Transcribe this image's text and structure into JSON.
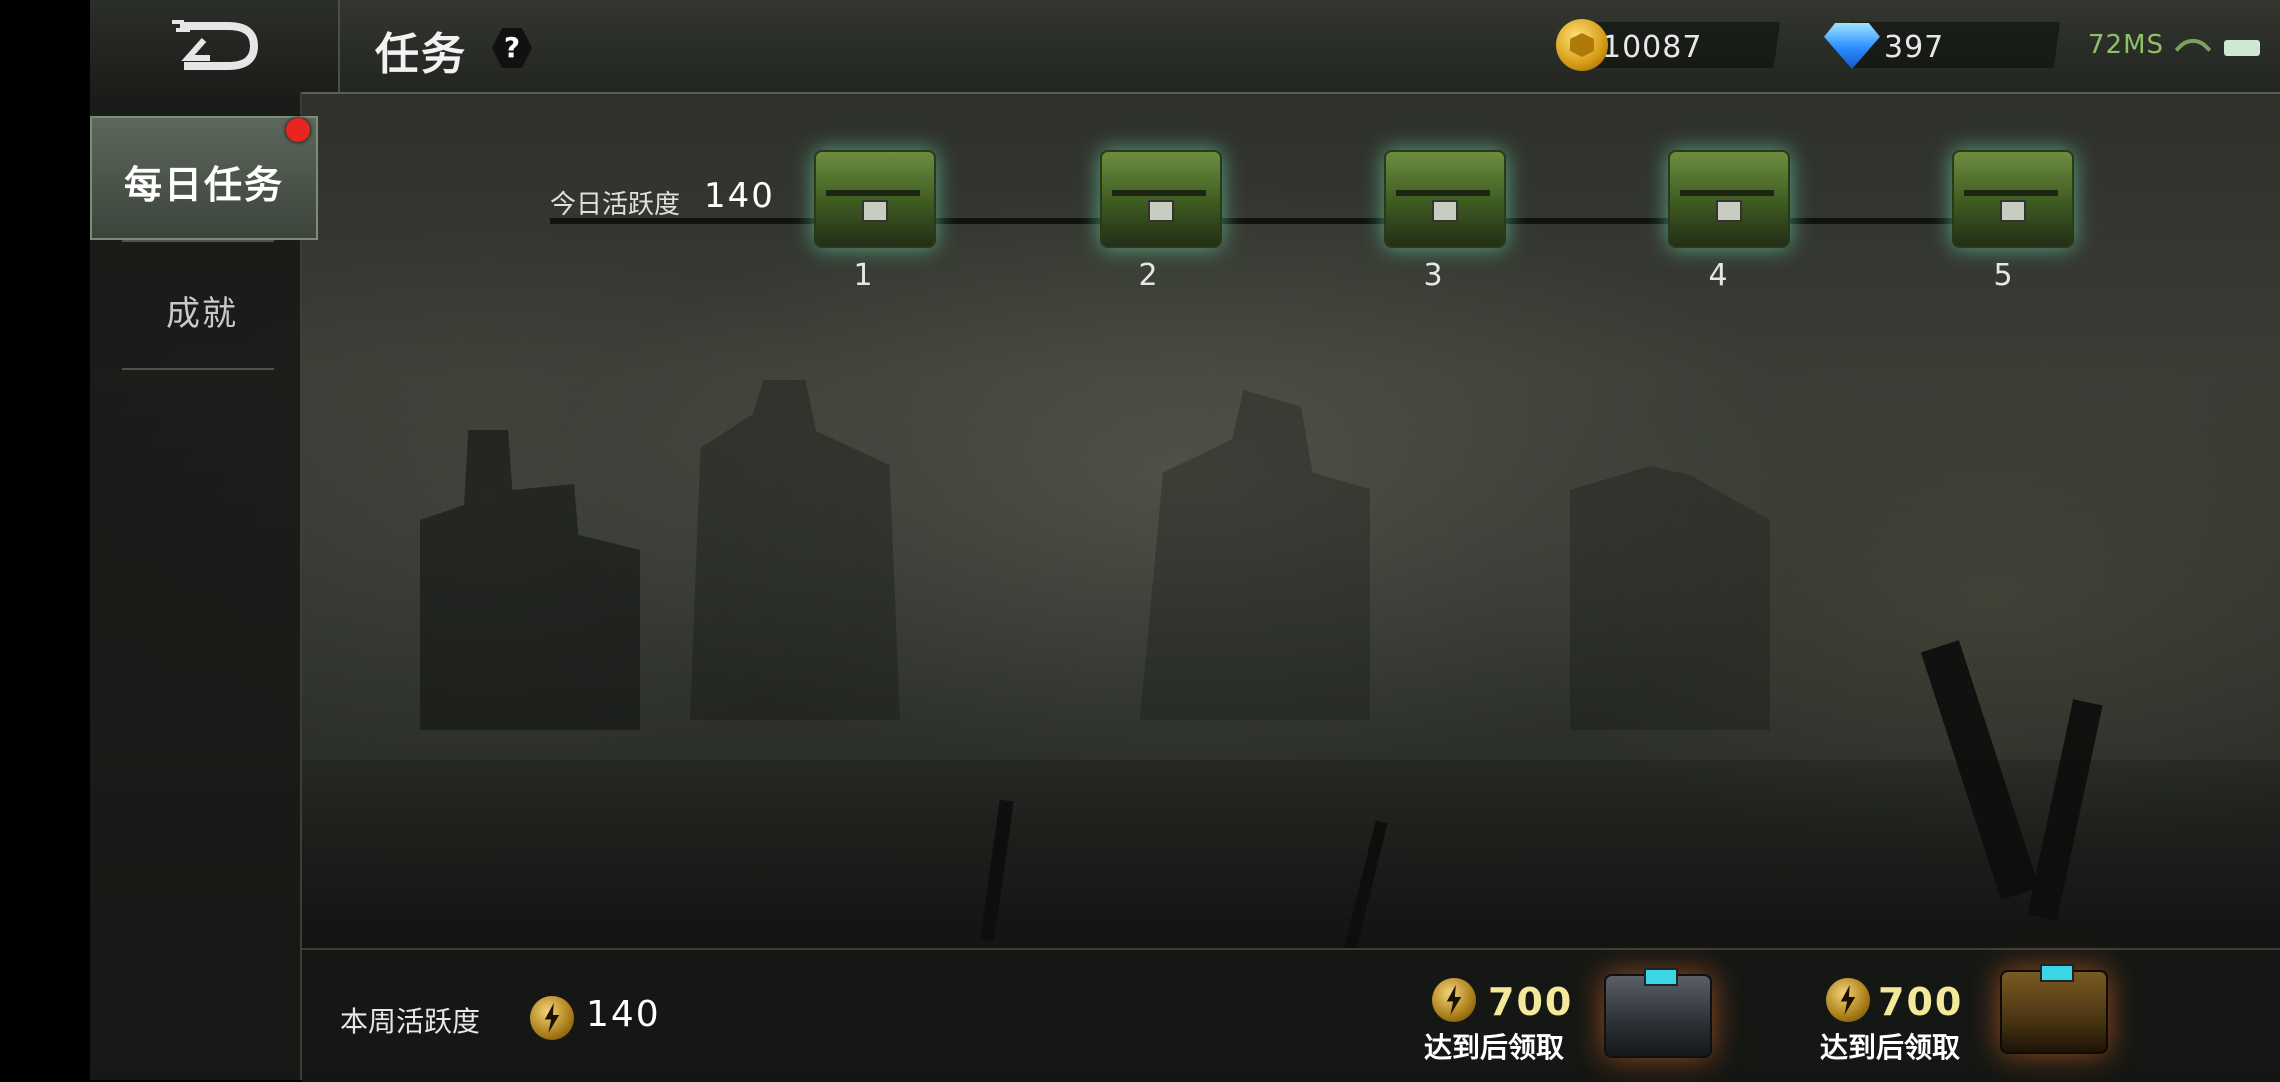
{
  "header": {
    "title": "任务",
    "help_label": "?",
    "gold": "10087",
    "diamonds": "397",
    "ping": "72MS"
  },
  "sidebar": {
    "tabs": [
      {
        "label": "每日任务",
        "active": true,
        "badge": true
      },
      {
        "label": "成就",
        "active": false
      }
    ]
  },
  "daily": {
    "activity_label": "今日活跃度",
    "activity_value": "140",
    "chests": [
      "1",
      "2",
      "3",
      "4",
      "5"
    ]
  },
  "weekly": {
    "label": "本周活跃度",
    "value": "140",
    "rewards": [
      {
        "threshold": "700",
        "note": "达到后领取",
        "style": "steel"
      },
      {
        "threshold": "700",
        "note": "达到后领取",
        "style": "gold"
      }
    ]
  },
  "colors": {
    "accent_green": "#8fc06a",
    "badge_red": "#e8261f",
    "reward_yellow": "#f4e89a"
  },
  "icons": [
    "back-icon",
    "help-icon",
    "gold-coin-icon",
    "diamond-icon",
    "wifi-icon",
    "battery-icon",
    "bolt-icon",
    "chest-icon"
  ]
}
